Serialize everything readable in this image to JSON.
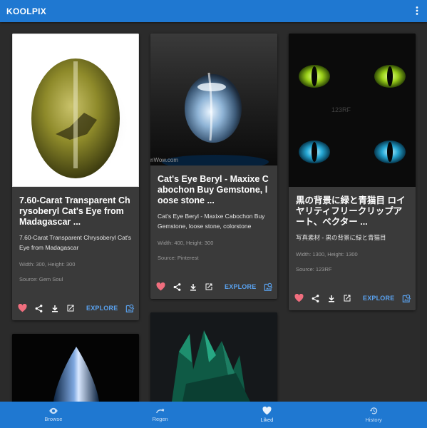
{
  "app": {
    "title": "KOOLPIX"
  },
  "cards": [
    {
      "title": "7.60-Carat Transparent Chrysoberyl Cat's Eye from Madagascar ...",
      "description": "7.60-Carat Transparent Chrysoberyl Cat's Eye from Madagascar",
      "meta": "Width: 300, Height: 300",
      "source": "Source: Gem Soul",
      "explore": "EXPLORE"
    },
    {
      "title": "Cat's Eye Beryl - Maxixe Cabochon Buy Gemstone, loose stone ...",
      "description": "Cat's Eye Beryl - Maxixe Cabochon Buy Gemstone, loose stone, colorstone",
      "meta": "Width: 400, Height: 300",
      "source": "Source: Pinterest",
      "explore": "EXPLORE",
      "watermark": "nWow.com"
    },
    {
      "title": "黒の背景に緑と青猫目 ロイヤリティフリークリップアート、ベクター ...",
      "description": "写真素材 - 黒の背景に緑と青猫目",
      "meta": "Width: 1300, Height: 1300",
      "source": "Source: 123RF",
      "explore": "EXPLORE",
      "watermark": "123RF"
    }
  ],
  "nav": [
    {
      "label": "Browse",
      "icon": "eye-icon"
    },
    {
      "label": "Regen",
      "icon": "redo-icon"
    },
    {
      "label": "Liked",
      "icon": "heart-icon"
    },
    {
      "label": "History",
      "icon": "history-icon"
    }
  ],
  "colors": {
    "appbar": "#1f78d1",
    "background": "#2b2b2b",
    "card": "#3a3a3a",
    "accent": "#5aa2ef",
    "like": "#f06e7e"
  }
}
